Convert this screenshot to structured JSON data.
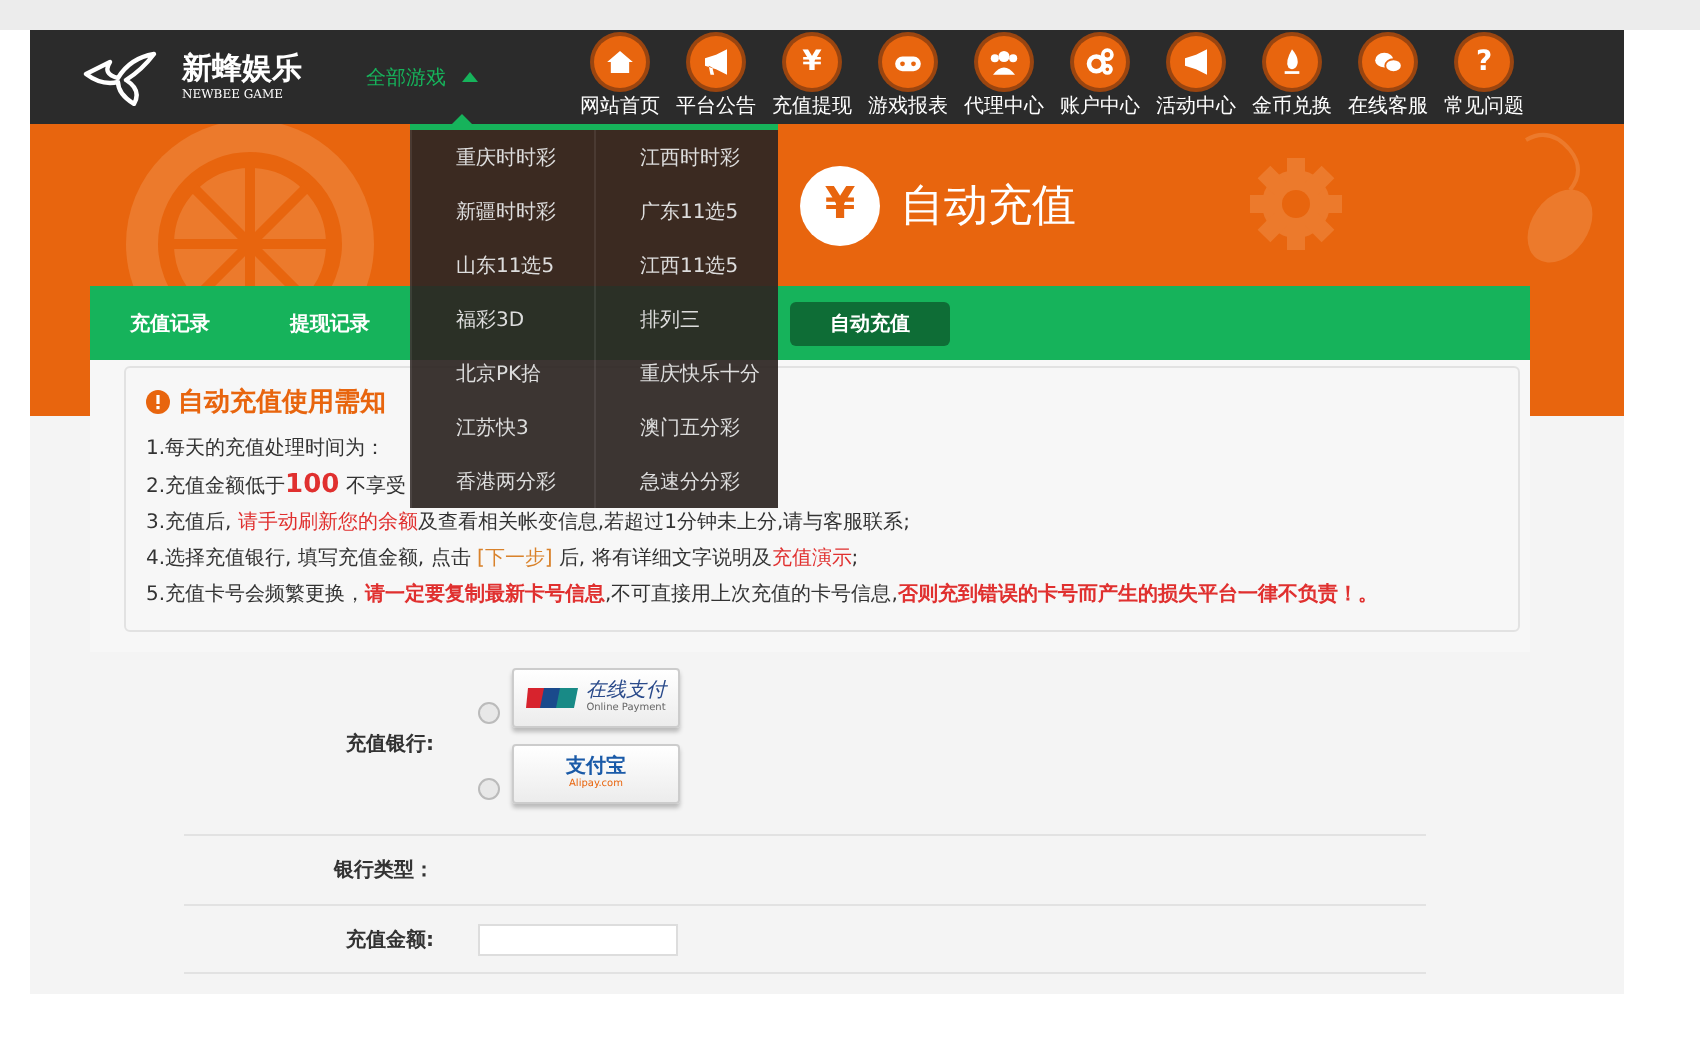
{
  "logo": {
    "name": "新蜂娱乐",
    "subtitle": "NEWBEE GAME"
  },
  "games_menu": {
    "label": "全部游戏",
    "expanded": true,
    "items": [
      {
        "label": "重庆时时彩"
      },
      {
        "label": "江西时时彩"
      },
      {
        "label": "新疆时时彩"
      },
      {
        "label": "广东11选5"
      },
      {
        "label": "山东11选5"
      },
      {
        "label": "江西11选5"
      },
      {
        "label": "福彩3D"
      },
      {
        "label": "排列三"
      },
      {
        "label": "北京PK拾"
      },
      {
        "label": "重庆快乐十分"
      },
      {
        "label": "江苏快3"
      },
      {
        "label": "澳门五分彩"
      },
      {
        "label": "香港两分彩"
      },
      {
        "label": "急速分分彩"
      }
    ]
  },
  "nav": [
    {
      "label": "网站首页"
    },
    {
      "label": "平台公告"
    },
    {
      "label": "充值提现",
      "glyph": "¥"
    },
    {
      "label": "游戏报表"
    },
    {
      "label": "代理中心"
    },
    {
      "label": "账户中心"
    },
    {
      "label": "活动中心"
    },
    {
      "label": "金币兑换"
    },
    {
      "label": "在线客服"
    },
    {
      "label": "常见问题",
      "glyph": "?"
    }
  ],
  "banner": {
    "glyph": "¥",
    "title": "自动充值"
  },
  "tabs": [
    {
      "label": "充值记录",
      "selected": false
    },
    {
      "label": "提现记录",
      "selected": false
    },
    {
      "label": "自动充值",
      "selected": true
    }
  ],
  "notice": {
    "title": "自动充值使用需知",
    "lines": [
      [
        {
          "text": "1.每天的充值处理时间为：",
          "kind": "plain"
        }
      ],
      [
        {
          "text": "2.充值金额低于",
          "kind": "plain"
        },
        {
          "text": "100",
          "kind": "big"
        },
        {
          "text": " 不享受",
          "kind": "plain"
        }
      ],
      [
        {
          "text": "3.充值后, ",
          "kind": "plain"
        },
        {
          "text": "请手动刷新您的余额",
          "kind": "red"
        },
        {
          "text": "及查看相关帐变信息,若超过1分钟未上分,请与客服联系;",
          "kind": "plain"
        }
      ],
      [
        {
          "text": "4.选择充值银行, 填写充值金额, 点击 ",
          "kind": "plain"
        },
        {
          "text": "[下一步]",
          "kind": "orange"
        },
        {
          "text": " 后, 将有详细文字说明及",
          "kind": "plain"
        },
        {
          "text": "充值演示",
          "kind": "red"
        },
        {
          "text": ";",
          "kind": "plain"
        }
      ],
      [
        {
          "text": "5.充值卡号会频繁更换，",
          "kind": "plain"
        },
        {
          "text": "请一定要复制最新卡号信息",
          "kind": "strong"
        },
        {
          "text": ",不可直接用上次充值的卡号信息,",
          "kind": "plain"
        },
        {
          "text": "否则充到错误的卡号而产生的损失平台一律不负责！。",
          "kind": "strong"
        }
      ]
    ]
  },
  "form": {
    "bank_label": "充值银行:",
    "banks": [
      {
        "kind": "unionpay",
        "name": "在线支付",
        "sub": "Online Payment",
        "checked": false
      },
      {
        "kind": "alipay",
        "name": "支付宝",
        "sub": "Alipay.com",
        "checked": false
      }
    ],
    "bank_type_label": "银行类型：",
    "amount_label": "充值金额:"
  }
}
